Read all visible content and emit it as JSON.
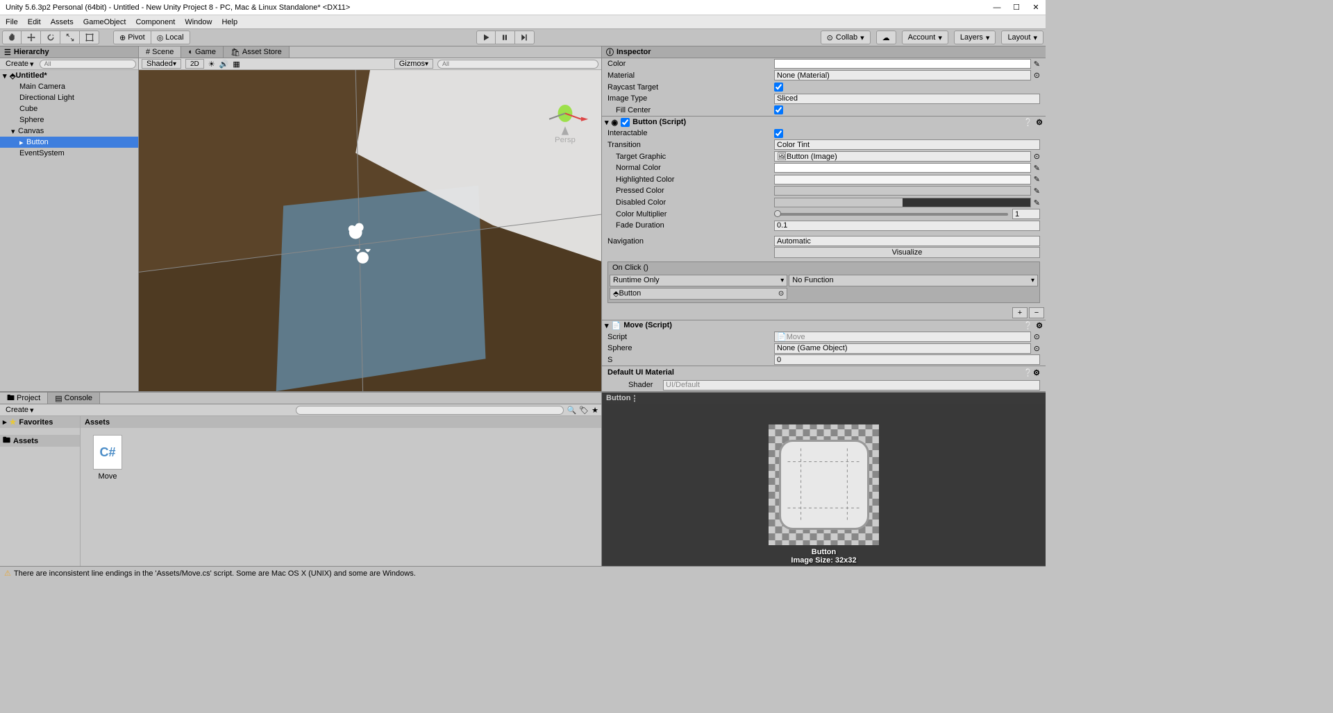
{
  "window": {
    "title": "Unity 5.6.3p2 Personal (64bit) - Untitled - New Unity Project 8 - PC, Mac & Linux Standalone* <DX11>"
  },
  "menu": {
    "file": "File",
    "edit": "Edit",
    "assets": "Assets",
    "gameobject": "GameObject",
    "component": "Component",
    "window": "Window",
    "help": "Help"
  },
  "toolbar": {
    "pivot": "Pivot",
    "local": "Local",
    "collab": "Collab",
    "account": "Account",
    "layers": "Layers",
    "layout": "Layout"
  },
  "hierarchy": {
    "title": "Hierarchy",
    "create": "Create",
    "search_ph": "All",
    "scene": "Untitled*",
    "items": [
      "Main Camera",
      "Directional Light",
      "Cube",
      "Sphere",
      "Canvas",
      "Button",
      "EventSystem"
    ]
  },
  "scene": {
    "tab_scene": "Scene",
    "tab_game": "Game",
    "tab_store": "Asset Store",
    "shaded": "Shaded",
    "mode_2d": "2D",
    "gizmos": "Gizmos",
    "search_ph": "All",
    "persp": "Persp"
  },
  "inspector": {
    "title": "Inspector",
    "image": {
      "color": "Color",
      "material": "Material",
      "material_val": "None (Material)",
      "raycast": "Raycast Target",
      "type": "Image Type",
      "type_val": "Sliced",
      "fill": "Fill Center"
    },
    "button": {
      "title": "Button (Script)",
      "interactable": "Interactable",
      "transition": "Transition",
      "transition_val": "Color Tint",
      "target": "Target Graphic",
      "target_val": "Button (Image)",
      "normal": "Normal Color",
      "highlight": "Highlighted Color",
      "pressed": "Pressed Color",
      "disabled": "Disabled Color",
      "mult": "Color Multiplier",
      "mult_val": "1",
      "fade": "Fade Duration",
      "fade_val": "0.1",
      "nav": "Navigation",
      "nav_val": "Automatic",
      "visualize": "Visualize",
      "onclick": "On Click ()",
      "runtime": "Runtime Only",
      "nofunc": "No Function",
      "btn_obj": "Button"
    },
    "move": {
      "title": "Move (Script)",
      "script": "Script",
      "script_val": "Move",
      "sphere": "Sphere",
      "sphere_val": "None (Game Object)",
      "s": "S",
      "s_val": "0"
    },
    "material": {
      "title": "Default UI Material",
      "shader": "Shader",
      "shader_val": "UI/Default"
    }
  },
  "project": {
    "tab_project": "Project",
    "tab_console": "Console",
    "create": "Create",
    "favorites": "Favorites",
    "assets": "Assets",
    "assets_header": "Assets",
    "move_script": "Move"
  },
  "preview": {
    "title": "Button",
    "name": "Button",
    "size": "Image Size: 32x32"
  },
  "status": {
    "warning": "There are inconsistent line endings in the 'Assets/Move.cs' script. Some are Mac OS X (UNIX) and some are Windows."
  }
}
